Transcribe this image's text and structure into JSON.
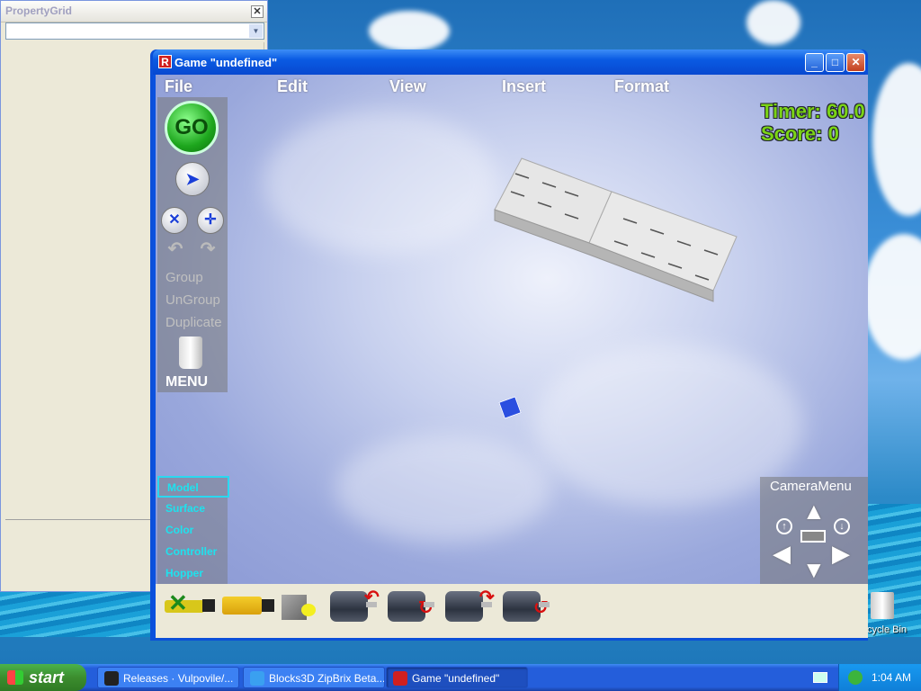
{
  "property_grid": {
    "title": "PropertyGrid",
    "close_label": "✕",
    "dropdown_value": ""
  },
  "game_window": {
    "title": "Game \"undefined\"",
    "minimize": "_",
    "maximize": "□",
    "close": "✕"
  },
  "menubar": [
    "File",
    "Edit",
    "View",
    "Insert",
    "Format"
  ],
  "hud": {
    "timer": "Timer: 60.0",
    "score": "Score: 0",
    "color": "#7bd415"
  },
  "toolbox": {
    "go_label": "GO",
    "group": "Group",
    "ungroup": "UnGroup",
    "duplicate": "Duplicate",
    "menu": "MENU"
  },
  "modes": [
    "Model",
    "Surface",
    "Color",
    "Controller",
    "Hopper"
  ],
  "camera": {
    "title": "CameraMenu"
  },
  "parts": [
    "delete-part-icon",
    "glue-tool-icon",
    "block-part-icon",
    "motor-left-icon",
    "motor-rotate-icon",
    "motor-right-icon",
    "motor-forward-icon"
  ],
  "taskbar": {
    "start": "start",
    "tasks": [
      "Releases · Vulpovile/...",
      "Blocks3D ZipBrix Beta...",
      "Game \"undefined\""
    ],
    "clock": "1:04 AM"
  },
  "desktop": {
    "recycle_bin": "cycle Bin"
  }
}
